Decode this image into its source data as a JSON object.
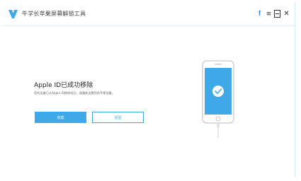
{
  "app": {
    "title": "牛学长苹果屏幕解锁工具"
  },
  "titlebar": {
    "facebook_label": "f",
    "menu_label": "≡",
    "close_label": "✕"
  },
  "main": {
    "headline": "Apple ID已成功移除",
    "subline": "您的设备已从Apple ID移除成功，请重新设置您的苹果设备。",
    "primary_button": "完成",
    "secondary_button": "返回"
  },
  "colors": {
    "accent": "#3fa9e8",
    "logo": "#3fa9e8",
    "check_circle": "#ffffff"
  },
  "icons": {
    "logo": "y-logo-icon",
    "facebook": "facebook-icon",
    "menu": "menu-icon",
    "minimize": "minimize-icon",
    "close": "close-icon",
    "phone": "phone-illustration",
    "check": "check-icon"
  }
}
